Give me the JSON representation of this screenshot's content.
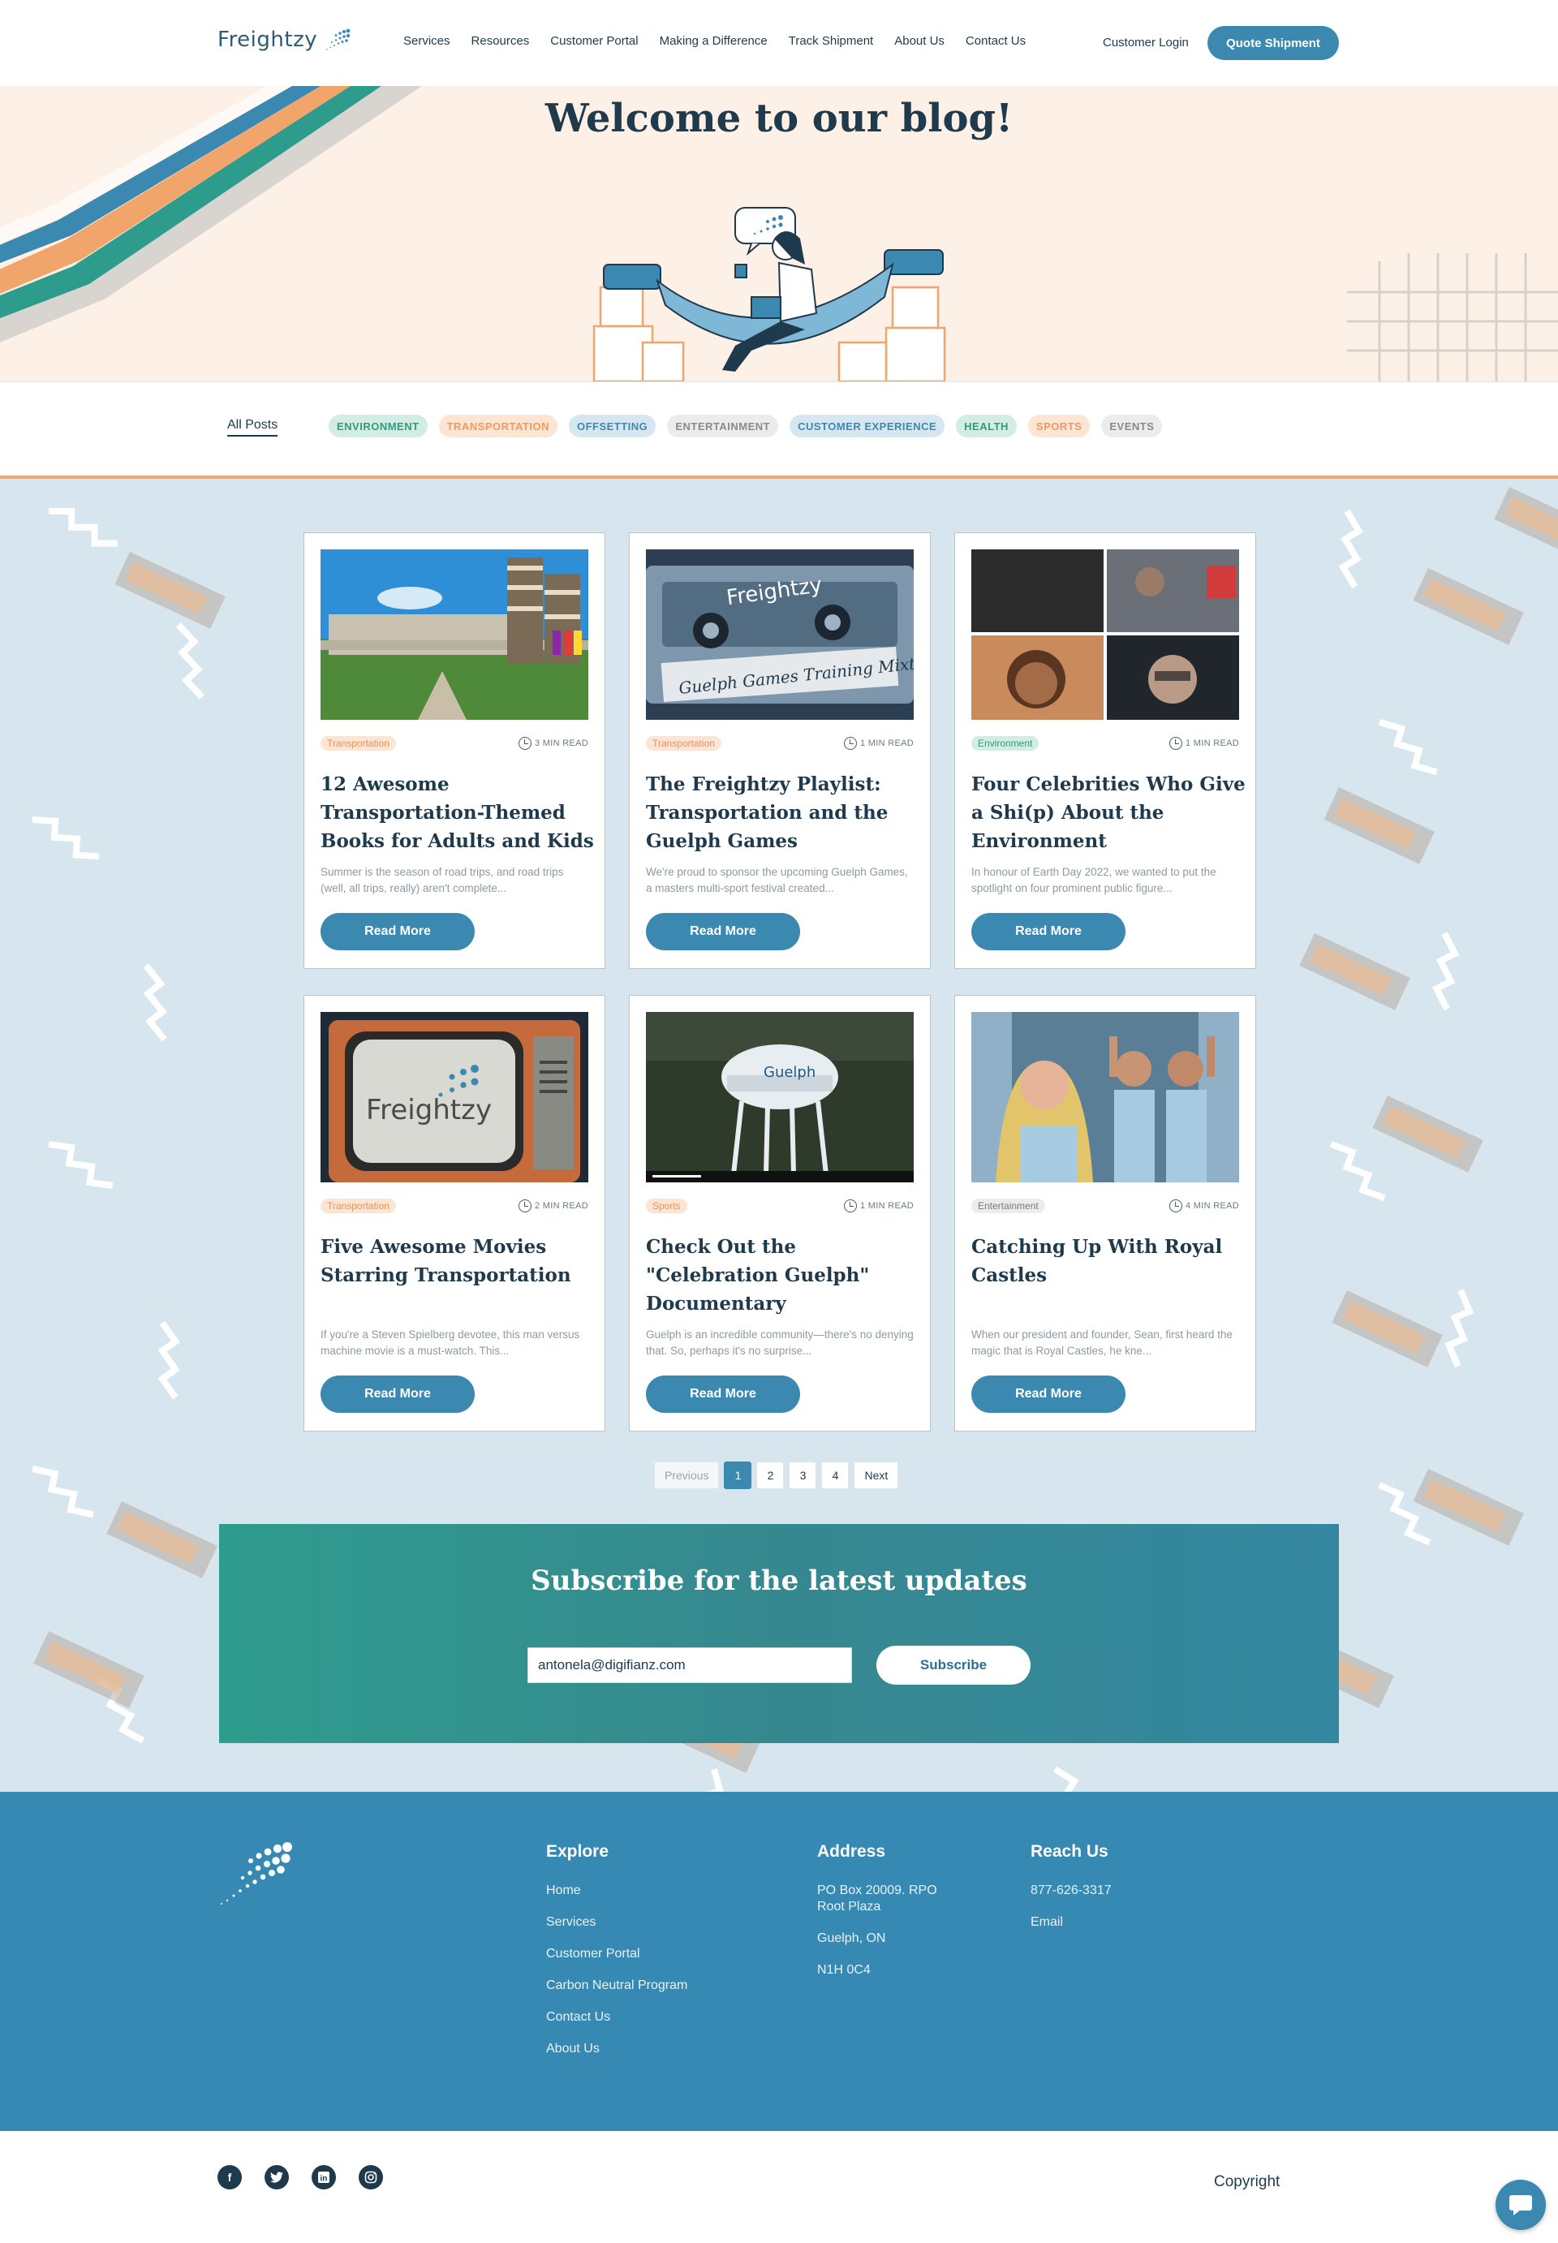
{
  "header": {
    "logo_text": "Freightzy",
    "nav": [
      "Services",
      "Resources",
      "Customer Portal",
      "Making a Difference",
      "Track Shipment",
      "About Us",
      "Contact Us"
    ],
    "login_label": "Customer Login",
    "quote_label": "Quote Shipment"
  },
  "hero": {
    "title": "Welcome to our blog!"
  },
  "filters": {
    "all_label": "All Posts",
    "chips": [
      {
        "label": "ENVIRONMENT",
        "bg": "#d2ede4",
        "fg": "#2f9a80"
      },
      {
        "label": "TRANSPORTATION",
        "bg": "#fde5d3",
        "fg": "#ee9a64"
      },
      {
        "label": "OFFSETTING",
        "bg": "#d6e7f2",
        "fg": "#3b88b1"
      },
      {
        "label": "ENTERTAINMENT",
        "bg": "#ececec",
        "fg": "#8a8a8a"
      },
      {
        "label": "CUSTOMER EXPERIENCE",
        "bg": "#d6e7f2",
        "fg": "#3b88b1"
      },
      {
        "label": "HEALTH",
        "bg": "#d2ede4",
        "fg": "#2f9a80"
      },
      {
        "label": "SPORTS",
        "bg": "#fde5d3",
        "fg": "#ee9a64"
      },
      {
        "label": "EVENTS",
        "bg": "#ececec",
        "fg": "#8a8a8a"
      }
    ]
  },
  "posts": [
    {
      "tag": "Transportation",
      "tag_bg": "#fde5d3",
      "tag_fg": "#e7935a",
      "read_time": "3 MIN READ",
      "title": "12 Awesome Transportation-Themed Books for Adults and Kids",
      "excerpt": "Summer is the season of road trips, and road trips (well, all trips, really) aren't complete...",
      "button": "Read More",
      "image": "library-books-photo"
    },
    {
      "tag": "Transportation",
      "tag_bg": "#fde5d3",
      "tag_fg": "#e7935a",
      "read_time": "1 MIN READ",
      "title": "The Freightzy Playlist: Transportation and the Guelph Games",
      "excerpt": "We're proud to sponsor the upcoming Guelph Games, a masters multi-sport festival created...",
      "button": "Read More",
      "image": "cassette-tape-photo"
    },
    {
      "tag": "Environment",
      "tag_bg": "#d2ede4",
      "tag_fg": "#2f9a80",
      "read_time": "1 MIN READ",
      "title": "Four Celebrities Who Give a Shi(p) About the Environment",
      "excerpt": "In honour of Earth Day 2022, we wanted to put the spotlight on four prominent public figure...",
      "button": "Read More",
      "image": "celebrity-collage-photo"
    },
    {
      "tag": "Transportation",
      "tag_bg": "#fde5d3",
      "tag_fg": "#e7935a",
      "read_time": "2 MIN READ",
      "title": "Five Awesome Movies Starring Transportation",
      "excerpt": "If you're a Steven Spielberg devotee, this man versus machine movie is a must-watch. This...",
      "button": "Read More",
      "image": "retro-tv-photo"
    },
    {
      "tag": "Sports",
      "tag_bg": "#fde5d3",
      "tag_fg": "#e7935a",
      "read_time": "1 MIN READ",
      "title": "Check Out the \"Celebration Guelph\" Documentary",
      "excerpt": "Guelph is an incredible community—there's no denying that. So, perhaps it's no surprise...",
      "button": "Read More",
      "image": "water-tower-video"
    },
    {
      "tag": "Entertainment",
      "tag_bg": "#ececec",
      "tag_fg": "#7a7a7a",
      "read_time": "4 MIN READ",
      "title": "Catching Up With Royal Castles",
      "excerpt": "When our president and founder, Sean, first heard the magic that is Royal Castles, he kne...",
      "button": "Read More",
      "image": "band-photo"
    }
  ],
  "pagination": {
    "previous": "Previous",
    "pages": [
      "1",
      "2",
      "3",
      "4"
    ],
    "current": "1",
    "next": "Next"
  },
  "subscribe": {
    "title": "Subscribe for the latest updates",
    "email_value": "antonela@digifianz.com",
    "button": "Subscribe"
  },
  "footer": {
    "explore": {
      "title": "Explore",
      "items": [
        "Home",
        "Services",
        "Customer Portal",
        "Carbon Neutral Program",
        "Contact Us",
        "About Us"
      ]
    },
    "address": {
      "title": "Address",
      "items": [
        "PO Box 20009. RPO Root Plaza",
        "Guelph, ON",
        "N1H 0C4"
      ]
    },
    "reach": {
      "title": "Reach Us",
      "items": [
        "877-626-3317",
        "Email"
      ]
    },
    "socials": [
      "facebook-icon",
      "twitter-icon",
      "linkedin-icon",
      "instagram-icon"
    ],
    "copyright": "Copyright"
  },
  "colors": {
    "primary": "#3b88b1",
    "navy": "#1e3a4c",
    "orange": "#f2a56b",
    "teal": "#2e9c8d",
    "peach": "#fdf0e6"
  }
}
